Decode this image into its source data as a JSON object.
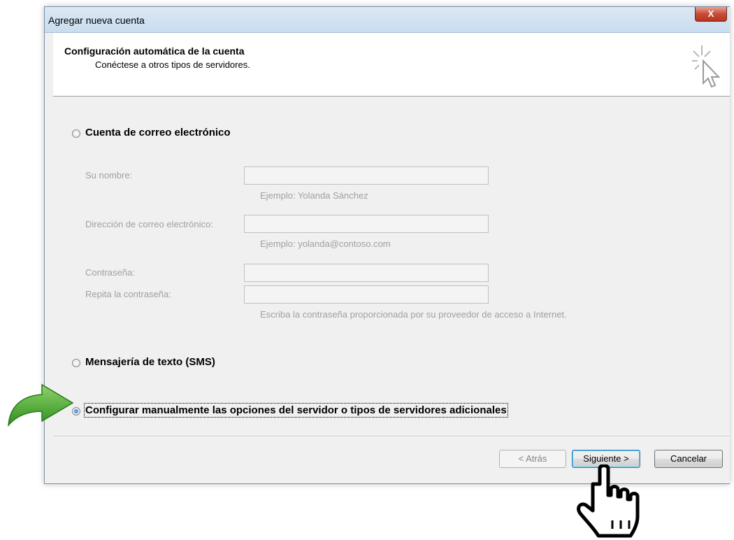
{
  "window": {
    "title": "Agregar nueva cuenta",
    "close_label": "X"
  },
  "header": {
    "title": "Configuración automática de la cuenta",
    "subtitle": "Conéctese a otros tipos de servidores."
  },
  "options": {
    "email_account": {
      "label": "Cuenta de correo electrónico",
      "checked": false
    },
    "sms": {
      "label": "Mensajería de texto (SMS)",
      "checked": false
    },
    "manual": {
      "label": "Configurar manualmente las opciones del servidor o tipos de servidores adicionales",
      "checked": true
    }
  },
  "fields": {
    "name": {
      "label": "Su nombre:",
      "value": "",
      "hint": "Ejemplo: Yolanda Sánchez"
    },
    "email": {
      "label": "Dirección de correo electrónico:",
      "value": "",
      "hint": "Ejemplo: yolanda@contoso.com"
    },
    "password": {
      "label": "Contraseña:",
      "value": ""
    },
    "password_repeat": {
      "label": "Repita la contraseña:",
      "value": "",
      "hint": "Escriba la contraseña proporcionada por su proveedor de acceso a Internet."
    }
  },
  "buttons": {
    "back": "< Atrás",
    "next": "Siguiente >",
    "cancel": "Cancelar"
  },
  "icons": {
    "header": "cursor-sparkle-icon",
    "arrow": "green-curved-arrow-icon",
    "hand": "hand-pointer-icon"
  },
  "colors": {
    "titlebar": "#c9dcee",
    "close_button": "#c74b35",
    "arrow_green": "#43a82a",
    "default_button_border": "#3c7fb1"
  }
}
